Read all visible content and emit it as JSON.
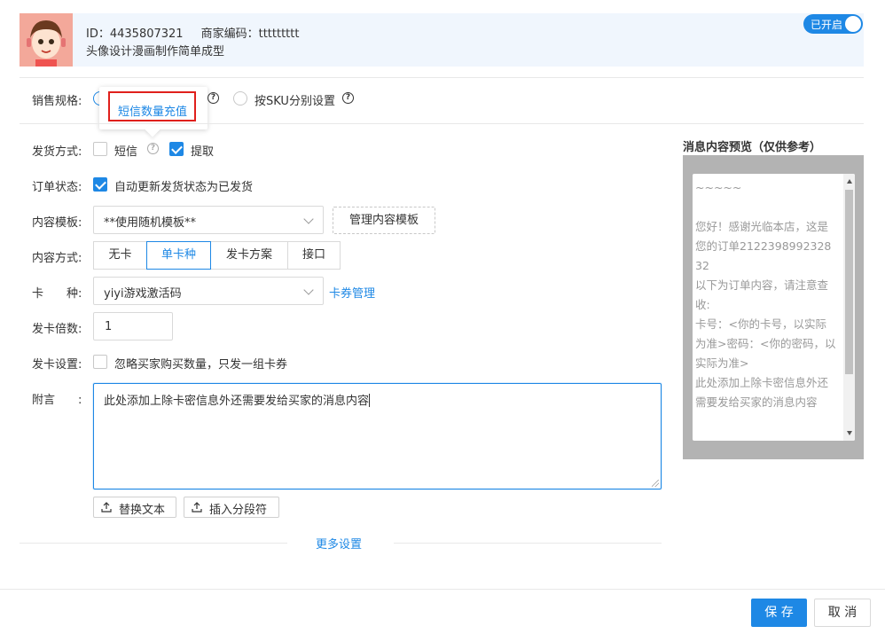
{
  "header": {
    "id_label": "ID：",
    "id_value": "4435807321",
    "merchant_code_label": "商家编码：",
    "merchant_code_value": "ttttttttt",
    "product_name": "头像设计漫画制作简单成型",
    "status_toggle": {
      "label": "已开启",
      "on": true
    }
  },
  "form": {
    "sales_spec": {
      "label": "销售规格:",
      "option_sku_label": "按SKU分别设置",
      "popover_link": "短信数量充值"
    },
    "delivery_method": {
      "label": "发货方式:",
      "sms_label": "短信",
      "sms_checked": false,
      "pickup_label": "提取",
      "pickup_checked": true
    },
    "order_status": {
      "label": "订单状态:",
      "auto_update_label": "自动更新发货状态为已发货",
      "checked": true
    },
    "content_template": {
      "label": "内容模板:",
      "selected": "**使用随机模板**",
      "manage_button": "管理内容模板"
    },
    "content_method": {
      "label": "内容方式:",
      "options": [
        "无卡",
        "单卡种",
        "发卡方案",
        "接口"
      ],
      "selected": "单卡种"
    },
    "card_type": {
      "label": "卡　　种:",
      "selected": "yiyi游戏激活码",
      "manage_link": "卡券管理"
    },
    "card_multiplier": {
      "label": "发卡倍数:",
      "value": "1"
    },
    "card_settings": {
      "label": "发卡设置:",
      "ignore_qty_label": "忽略买家购买数量，只发一组卡券",
      "checked": false
    },
    "note": {
      "label": "附言　　:",
      "value": "此处添加上除卡密信息外还需要发给买家的消息内容",
      "replace_text_button": "替换文本",
      "insert_separator_button": "插入分段符"
    },
    "more_settings": "更多设置"
  },
  "preview": {
    "title": "消息内容预览（仅供参考）",
    "content": "~~~~~\n\n您好！感谢光临本店，这是您的订单212239899232832\n以下为订单内容，请注意查收:\n卡号：<你的卡号，以实际为准>密码：<你的密码，以实际为准>\n此处添加上除卡密信息外还需要发给买家的消息内容"
  },
  "footer": {
    "save": "保 存",
    "cancel": "取 消"
  },
  "colors": {
    "accent": "#1e88e5",
    "header_bg": "#f0f6fd",
    "preview_bg": "#b3b3b3",
    "highlight": "#e0201c"
  }
}
